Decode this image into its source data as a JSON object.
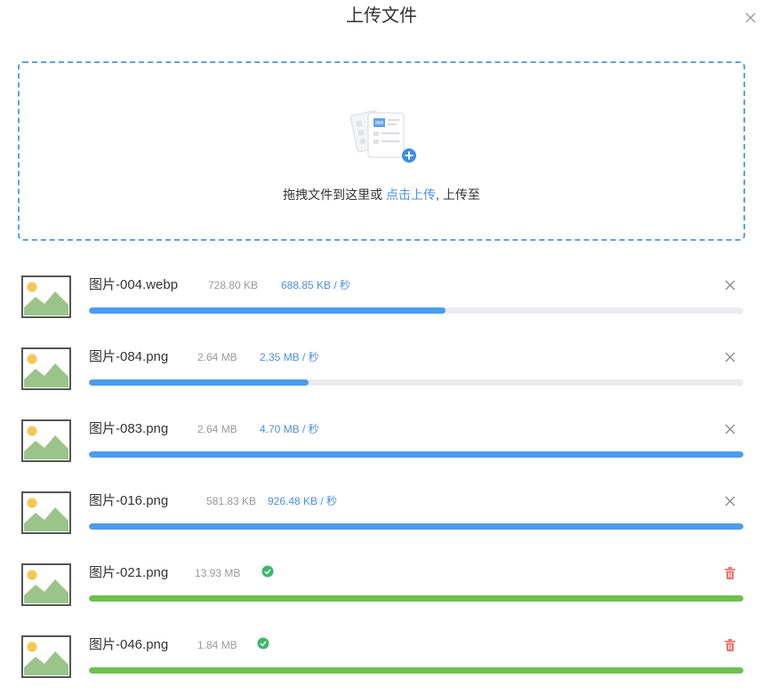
{
  "dialog": {
    "title": "上传文件"
  },
  "dropzone": {
    "text_before": "拖拽文件到这里或 ",
    "link_text": "点击上传",
    "text_after": ", 上传至"
  },
  "colors": {
    "uploading": "#4a9cf1",
    "done": "#6cc24a",
    "accent": "#4a90e2",
    "success_icon": "#3cb96b",
    "delete_icon": "#e8766f"
  },
  "files": [
    {
      "name": "图片-004.webp",
      "size": "728.80 KB",
      "speed": "688.85 KB / 秒",
      "status": "uploading",
      "progress": 0.545,
      "action_icon": "close-icon"
    },
    {
      "name": "图片-084.png",
      "size": "2.64 MB",
      "speed": "2.35 MB / 秒",
      "status": "uploading",
      "progress": 0.335,
      "action_icon": "close-icon"
    },
    {
      "name": "图片-083.png",
      "size": "2.64 MB",
      "speed": "4.70 MB / 秒",
      "status": "uploading",
      "progress": 1.0,
      "action_icon": "close-icon"
    },
    {
      "name": "图片-016.png",
      "size": "581.83 KB",
      "speed": "926.48 KB / 秒",
      "status": "uploading",
      "progress": 1.0,
      "action_icon": "close-icon"
    },
    {
      "name": "图片-021.png",
      "size": "13.93 MB",
      "speed": "",
      "status": "done",
      "progress": 1.0,
      "action_icon": "trash-icon"
    },
    {
      "name": "图片-046.png",
      "size": "1.84 MB",
      "speed": "",
      "status": "done",
      "progress": 1.0,
      "action_icon": "trash-icon"
    }
  ]
}
